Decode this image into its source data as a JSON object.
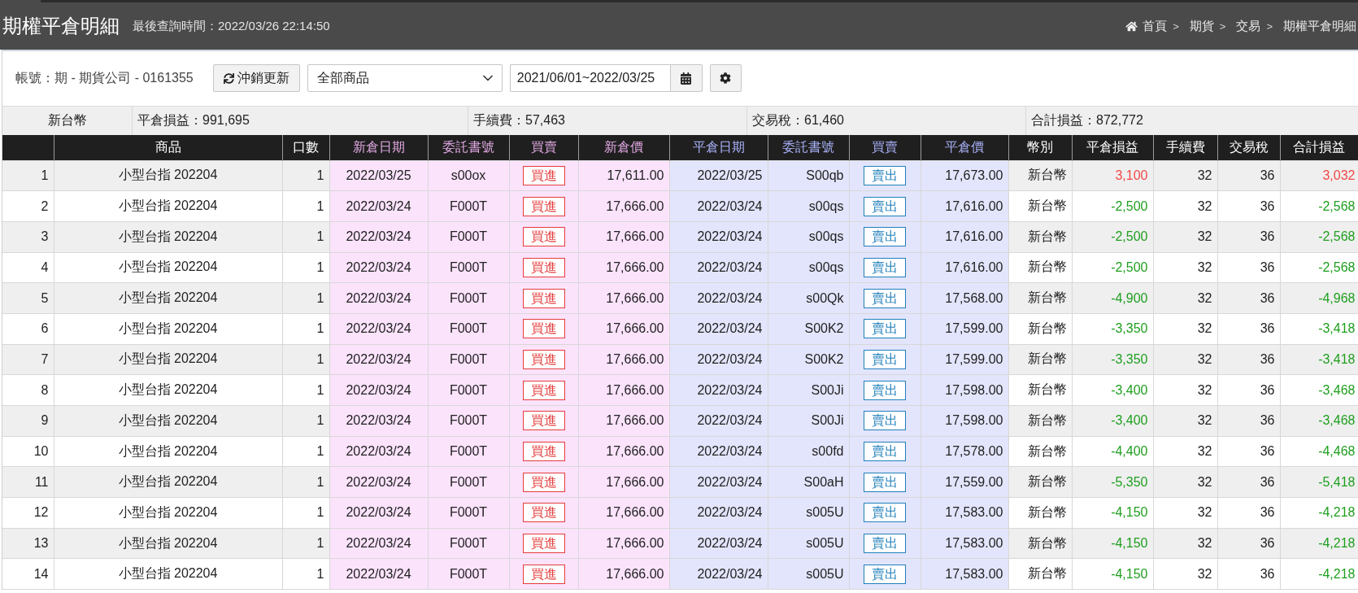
{
  "header": {
    "title": "期權平倉明細",
    "last_query": "最後查詢時間：2022/03/26 22:14:50",
    "breadcrumb": [
      {
        "label": "首頁",
        "separator": ">"
      },
      {
        "label": "期貨",
        "separator": ">"
      },
      {
        "label": "交易",
        "separator": ">"
      },
      {
        "label": "期權平倉明細"
      }
    ]
  },
  "toolbar": {
    "account": "帳號：期 - 期貨公司 - 0161355",
    "refresh_button": "沖銷更新",
    "product_select": "全部商品",
    "date_range": "2021/06/01~2022/03/25"
  },
  "summary": {
    "currency": "新台幣",
    "items": [
      "平倉損益：991,695",
      "手續費：57,463",
      "交易稅：61,460",
      "合計損益：872,772"
    ]
  },
  "table": {
    "columns": [
      {
        "label": "商品",
        "kind": "plain"
      },
      {
        "label": "口數",
        "kind": "plain"
      },
      {
        "label": "新倉日期",
        "kind": "open"
      },
      {
        "label": "委託書號",
        "kind": "open"
      },
      {
        "label": "買賣",
        "kind": "open"
      },
      {
        "label": "新倉價",
        "kind": "open"
      },
      {
        "label": "平倉日期",
        "kind": "close"
      },
      {
        "label": "委託書號",
        "kind": "close"
      },
      {
        "label": "買賣",
        "kind": "close"
      },
      {
        "label": "平倉價",
        "kind": "close"
      },
      {
        "label": "幣別",
        "kind": "plain"
      },
      {
        "label": "平倉損益",
        "kind": "plain"
      },
      {
        "label": "手續費",
        "kind": "plain"
      },
      {
        "label": "交易稅",
        "kind": "plain"
      },
      {
        "label": "合計損益",
        "kind": "plain"
      }
    ],
    "rows": [
      {
        "no": "1",
        "product": "小型台指 202204",
        "qty": "1",
        "open_date": "2022/03/25",
        "open_order": "s00ox",
        "open_side": "買進",
        "open_price": "17,611.00",
        "close_date": "2022/03/25",
        "close_order": "S00qb",
        "close_side": "賣出",
        "close_price": "17,673.00",
        "currency": "新台幣",
        "pnl": "3,100",
        "fee": "32",
        "tax": "36",
        "total": "3,032",
        "color": "#f24848"
      },
      {
        "no": "2",
        "product": "小型台指 202204",
        "qty": "1",
        "open_date": "2022/03/24",
        "open_order": "F000T",
        "open_side": "買進",
        "open_price": "17,666.00",
        "close_date": "2022/03/24",
        "close_order": "s00qs",
        "close_side": "賣出",
        "close_price": "17,616.00",
        "currency": "新台幣",
        "pnl": "-2,500",
        "fee": "32",
        "tax": "36",
        "total": "-2,568",
        "color": "#1f9f1f"
      },
      {
        "no": "3",
        "product": "小型台指 202204",
        "qty": "1",
        "open_date": "2022/03/24",
        "open_order": "F000T",
        "open_side": "買進",
        "open_price": "17,666.00",
        "close_date": "2022/03/24",
        "close_order": "s00qs",
        "close_side": "賣出",
        "close_price": "17,616.00",
        "currency": "新台幣",
        "pnl": "-2,500",
        "fee": "32",
        "tax": "36",
        "total": "-2,568",
        "color": "#1f9f1f"
      },
      {
        "no": "4",
        "product": "小型台指 202204",
        "qty": "1",
        "open_date": "2022/03/24",
        "open_order": "F000T",
        "open_side": "買進",
        "open_price": "17,666.00",
        "close_date": "2022/03/24",
        "close_order": "s00qs",
        "close_side": "賣出",
        "close_price": "17,616.00",
        "currency": "新台幣",
        "pnl": "-2,500",
        "fee": "32",
        "tax": "36",
        "total": "-2,568",
        "color": "#1f9f1f"
      },
      {
        "no": "5",
        "product": "小型台指 202204",
        "qty": "1",
        "open_date": "2022/03/24",
        "open_order": "F000T",
        "open_side": "買進",
        "open_price": "17,666.00",
        "close_date": "2022/03/24",
        "close_order": "s00Qk",
        "close_side": "賣出",
        "close_price": "17,568.00",
        "currency": "新台幣",
        "pnl": "-4,900",
        "fee": "32",
        "tax": "36",
        "total": "-4,968",
        "color": "#1f9f1f"
      },
      {
        "no": "6",
        "product": "小型台指 202204",
        "qty": "1",
        "open_date": "2022/03/24",
        "open_order": "F000T",
        "open_side": "買進",
        "open_price": "17,666.00",
        "close_date": "2022/03/24",
        "close_order": "S00K2",
        "close_side": "賣出",
        "close_price": "17,599.00",
        "currency": "新台幣",
        "pnl": "-3,350",
        "fee": "32",
        "tax": "36",
        "total": "-3,418",
        "color": "#1f9f1f"
      },
      {
        "no": "7",
        "product": "小型台指 202204",
        "qty": "1",
        "open_date": "2022/03/24",
        "open_order": "F000T",
        "open_side": "買進",
        "open_price": "17,666.00",
        "close_date": "2022/03/24",
        "close_order": "S00K2",
        "close_side": "賣出",
        "close_price": "17,599.00",
        "currency": "新台幣",
        "pnl": "-3,350",
        "fee": "32",
        "tax": "36",
        "total": "-3,418",
        "color": "#1f9f1f"
      },
      {
        "no": "8",
        "product": "小型台指 202204",
        "qty": "1",
        "open_date": "2022/03/24",
        "open_order": "F000T",
        "open_side": "買進",
        "open_price": "17,666.00",
        "close_date": "2022/03/24",
        "close_order": "S00Ji",
        "close_side": "賣出",
        "close_price": "17,598.00",
        "currency": "新台幣",
        "pnl": "-3,400",
        "fee": "32",
        "tax": "36",
        "total": "-3,468",
        "color": "#1f9f1f"
      },
      {
        "no": "9",
        "product": "小型台指 202204",
        "qty": "1",
        "open_date": "2022/03/24",
        "open_order": "F000T",
        "open_side": "買進",
        "open_price": "17,666.00",
        "close_date": "2022/03/24",
        "close_order": "S00Ji",
        "close_side": "賣出",
        "close_price": "17,598.00",
        "currency": "新台幣",
        "pnl": "-3,400",
        "fee": "32",
        "tax": "36",
        "total": "-3,468",
        "color": "#1f9f1f"
      },
      {
        "no": "10",
        "product": "小型台指 202204",
        "qty": "1",
        "open_date": "2022/03/24",
        "open_order": "F000T",
        "open_side": "買進",
        "open_price": "17,666.00",
        "close_date": "2022/03/24",
        "close_order": "s00fd",
        "close_side": "賣出",
        "close_price": "17,578.00",
        "currency": "新台幣",
        "pnl": "-4,400",
        "fee": "32",
        "tax": "36",
        "total": "-4,468",
        "color": "#1f9f1f"
      },
      {
        "no": "11",
        "product": "小型台指 202204",
        "qty": "1",
        "open_date": "2022/03/24",
        "open_order": "F000T",
        "open_side": "買進",
        "open_price": "17,666.00",
        "close_date": "2022/03/24",
        "close_order": "S00aH",
        "close_side": "賣出",
        "close_price": "17,559.00",
        "currency": "新台幣",
        "pnl": "-5,350",
        "fee": "32",
        "tax": "36",
        "total": "-5,418",
        "color": "#1f9f1f"
      },
      {
        "no": "12",
        "product": "小型台指 202204",
        "qty": "1",
        "open_date": "2022/03/24",
        "open_order": "F000T",
        "open_side": "買進",
        "open_price": "17,666.00",
        "close_date": "2022/03/24",
        "close_order": "s005U",
        "close_side": "賣出",
        "close_price": "17,583.00",
        "currency": "新台幣",
        "pnl": "-4,150",
        "fee": "32",
        "tax": "36",
        "total": "-4,218",
        "color": "#1f9f1f"
      },
      {
        "no": "13",
        "product": "小型台指 202204",
        "qty": "1",
        "open_date": "2022/03/24",
        "open_order": "F000T",
        "open_side": "買進",
        "open_price": "17,666.00",
        "close_date": "2022/03/24",
        "close_order": "s005U",
        "close_side": "賣出",
        "close_price": "17,583.00",
        "currency": "新台幣",
        "pnl": "-4,150",
        "fee": "32",
        "tax": "36",
        "total": "-4,218",
        "color": "#1f9f1f"
      },
      {
        "no": "14",
        "product": "小型台指 202204",
        "qty": "1",
        "open_date": "2022/03/24",
        "open_order": "F000T",
        "open_side": "買進",
        "open_price": "17,666.00",
        "close_date": "2022/03/24",
        "close_order": "s005U",
        "close_side": "賣出",
        "close_price": "17,583.00",
        "currency": "新台幣",
        "pnl": "-4,150",
        "fee": "32",
        "tax": "36",
        "total": "-4,218",
        "color": "#1f9f1f"
      }
    ]
  }
}
